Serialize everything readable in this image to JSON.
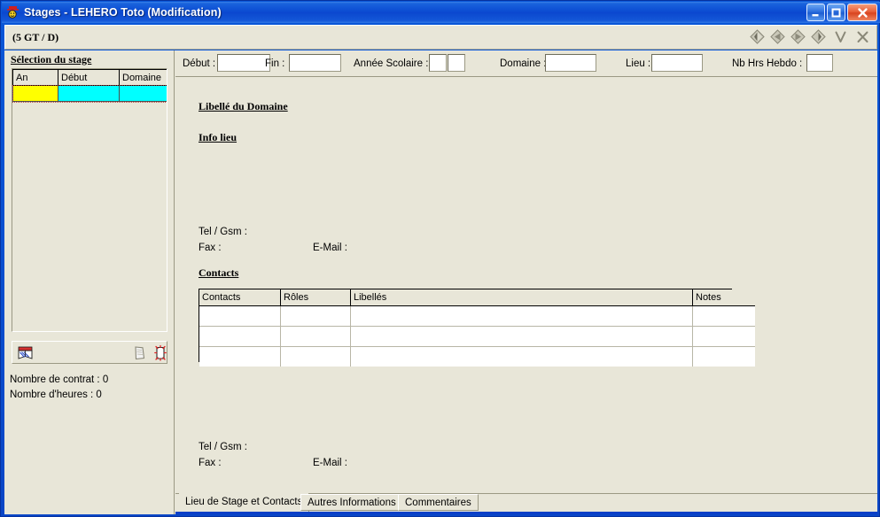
{
  "window": {
    "title_app": "Stages",
    "title_rest": " - LEHERO Toto (Modification)",
    "icon": "app-mascot-icon",
    "caption": {
      "minimize": "minimize-icon",
      "maximize": "maximize-icon",
      "close": "close-icon"
    },
    "accent_blue": "#0b3fc8",
    "face_color": "#e8e6d8"
  },
  "subheader": {
    "label": "(5 GT / D)",
    "nav": [
      {
        "name": "first-record-button",
        "icon": "diamond-first-icon"
      },
      {
        "name": "previous-record-button",
        "icon": "diamond-previous-icon"
      },
      {
        "name": "next-record-button",
        "icon": "diamond-next-icon"
      },
      {
        "name": "last-record-button",
        "icon": "diamond-last-icon"
      },
      {
        "name": "validate-button",
        "icon": "check-v-icon"
      },
      {
        "name": "cancel-button",
        "icon": "cross-x-icon"
      }
    ]
  },
  "sidebar": {
    "title": "Sélection du stage",
    "grid": {
      "columns": [
        "An",
        "Début",
        "Domaine"
      ],
      "rows": [
        {
          "an": "",
          "debut": "",
          "domaine": "",
          "selected": true
        }
      ],
      "selected_cell_color": "#ffff00",
      "selected_row_color": "#00ffff"
    },
    "toolbar": [
      {
        "name": "open-book-icon",
        "label": ""
      },
      {
        "name": "delete-page-icon",
        "label": ""
      },
      {
        "name": "new-page-icon",
        "label": ""
      }
    ],
    "counters": [
      "Nombre de contrat : 0",
      "Nombre d'heures : 0"
    ]
  },
  "form": {
    "fields": [
      {
        "label": "Début :",
        "value": "",
        "name": "debut-input"
      },
      {
        "label": "Fin :",
        "value": "",
        "name": "fin-input"
      },
      {
        "label": "Année Scolaire :",
        "value": "",
        "name": "annee-scolaire-input-1"
      },
      {
        "label": "",
        "value": "",
        "name": "annee-scolaire-input-2"
      },
      {
        "label": "Domaine :",
        "value": "",
        "name": "domaine-input"
      },
      {
        "label": "Lieu :",
        "value": "",
        "name": "lieu-input"
      },
      {
        "label": "Nb Hrs Hebdo :",
        "value": "",
        "name": "nb-hrs-hebdo-input"
      }
    ]
  },
  "content": {
    "heading_domaine": "Libellé du Domaine",
    "heading_info_lieu": "Info lieu ",
    "heading_contacts": "Contacts",
    "lieu_contact": {
      "tel_label": "Tel / Gsm :",
      "tel_value": "",
      "fax_label": "Fax :",
      "fax_value": "",
      "email_label": "E-Mail :",
      "email_value": ""
    },
    "bottom_contact": {
      "tel_label": "Tel / Gsm :",
      "tel_value": "",
      "fax_label": "Fax :",
      "fax_value": "",
      "email_label": "E-Mail :",
      "email_value": ""
    },
    "contacts_table": {
      "columns": [
        "Contacts",
        "Rôles",
        "Libellés",
        "Notes"
      ],
      "rows": [
        {
          "contacts": "",
          "roles": "",
          "libelles": "",
          "notes": ""
        },
        {
          "contacts": "",
          "roles": "",
          "libelles": "",
          "notes": ""
        },
        {
          "contacts": "",
          "roles": "",
          "libelles": "",
          "notes": ""
        }
      ]
    }
  },
  "tabs": [
    {
      "label": "Lieu de Stage et Contacts",
      "active": true,
      "name": "tab-lieu-de-stage-et-contacts"
    },
    {
      "label": "Autres Informations",
      "active": false,
      "name": "tab-autres-informations"
    },
    {
      "label": "Commentaires",
      "active": false,
      "name": "tab-commentaires"
    }
  ]
}
